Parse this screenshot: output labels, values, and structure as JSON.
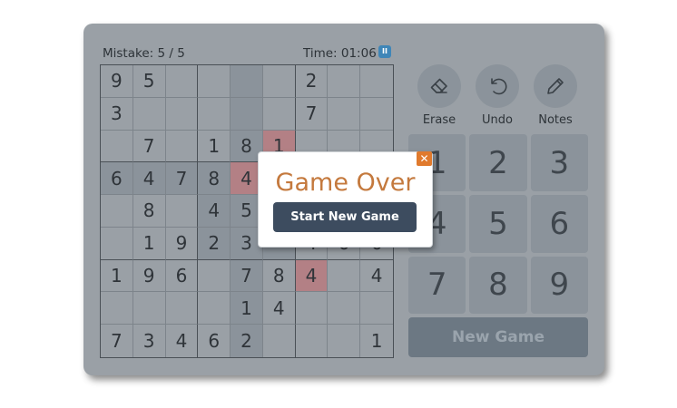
{
  "hud": {
    "mistake": "Mistake: 5 / 5",
    "time": "Time: 01:06",
    "pause_symbol": "II"
  },
  "board": [
    [
      "9",
      "5",
      "",
      "",
      "",
      "",
      "2",
      "",
      ""
    ],
    [
      "3",
      "",
      "",
      "",
      "",
      "",
      "7",
      "",
      ""
    ],
    [
      "",
      "7",
      "",
      "1",
      "8",
      "1",
      "",
      "",
      ""
    ],
    [
      "6",
      "4",
      "7",
      "8",
      "4",
      "",
      "",
      "",
      ""
    ],
    [
      "",
      "8",
      "",
      "4",
      "5",
      "",
      "",
      "",
      ""
    ],
    [
      "",
      "1",
      "9",
      "2",
      "3",
      "",
      "4",
      "6",
      "6"
    ],
    [
      "1",
      "9",
      "6",
      "",
      "7",
      "8",
      "4",
      "",
      "4"
    ],
    [
      "",
      "",
      "",
      "",
      "1",
      "4",
      "",
      "",
      ""
    ],
    [
      "7",
      "3",
      "4",
      "6",
      "2",
      "",
      "",
      "",
      "1"
    ]
  ],
  "tools": [
    {
      "label": "Erase",
      "icon": "eraser-icon"
    },
    {
      "label": "Undo",
      "icon": "undo-icon"
    },
    {
      "label": "Notes",
      "icon": "pencil-icon"
    }
  ],
  "numpad": [
    "1",
    "2",
    "3",
    "4",
    "5",
    "6",
    "7",
    "8",
    "9"
  ],
  "new_game": "New Game",
  "modal": {
    "title": "Game Over",
    "button": "Start New Game",
    "close_symbol": "✕"
  },
  "colors": {
    "accent": "#c4793d",
    "close": "#e07a2d",
    "primary_button": "#3d4c5f",
    "error_cell": "#b38085"
  }
}
